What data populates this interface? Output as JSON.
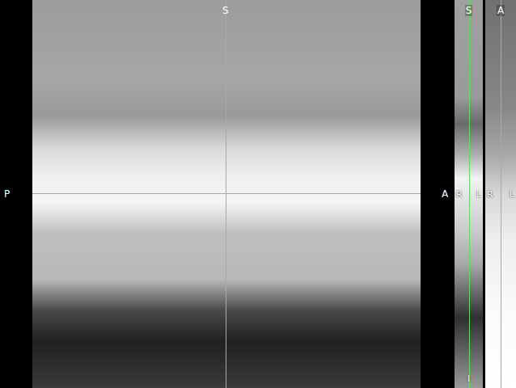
{
  "main_view": {
    "top": "S",
    "left": "P",
    "right": "A"
  },
  "side_views": [
    {
      "top": "S",
      "middle": [
        "R",
        "L"
      ],
      "bottom": "I"
    },
    {
      "top": "A",
      "middle": [
        "R",
        "L"
      ]
    }
  ]
}
